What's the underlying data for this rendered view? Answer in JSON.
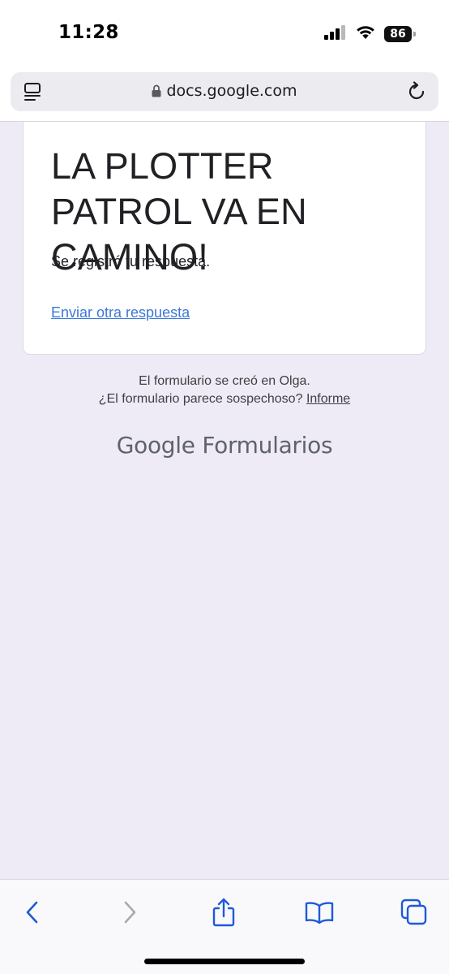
{
  "status_bar": {
    "time": "11:28",
    "battery_level": "86"
  },
  "browser": {
    "url": "docs.google.com"
  },
  "form": {
    "title": "LA PLOTTER PATROL VA EN CAMINO!",
    "confirmation_text": "Se registró tu respuesta.",
    "another_response_link": "Enviar otra respuesta"
  },
  "footer": {
    "created_in": "El formulario se creó en Olga.",
    "suspicious_prompt": "¿El formulario parece sospechoso?",
    "report_link": "Informe",
    "brand_google": "Google",
    "brand_product": "Formularios"
  },
  "colors": {
    "page_background": "#efebf6",
    "link": "#3c78d8",
    "toolbar_icon": "#1e5ad6"
  },
  "icons": [
    "signal-icon",
    "wifi-icon",
    "battery-icon",
    "reader-icon",
    "lock-icon",
    "reload-icon",
    "back-icon",
    "forward-icon",
    "share-icon",
    "bookmarks-icon",
    "tabs-icon"
  ]
}
